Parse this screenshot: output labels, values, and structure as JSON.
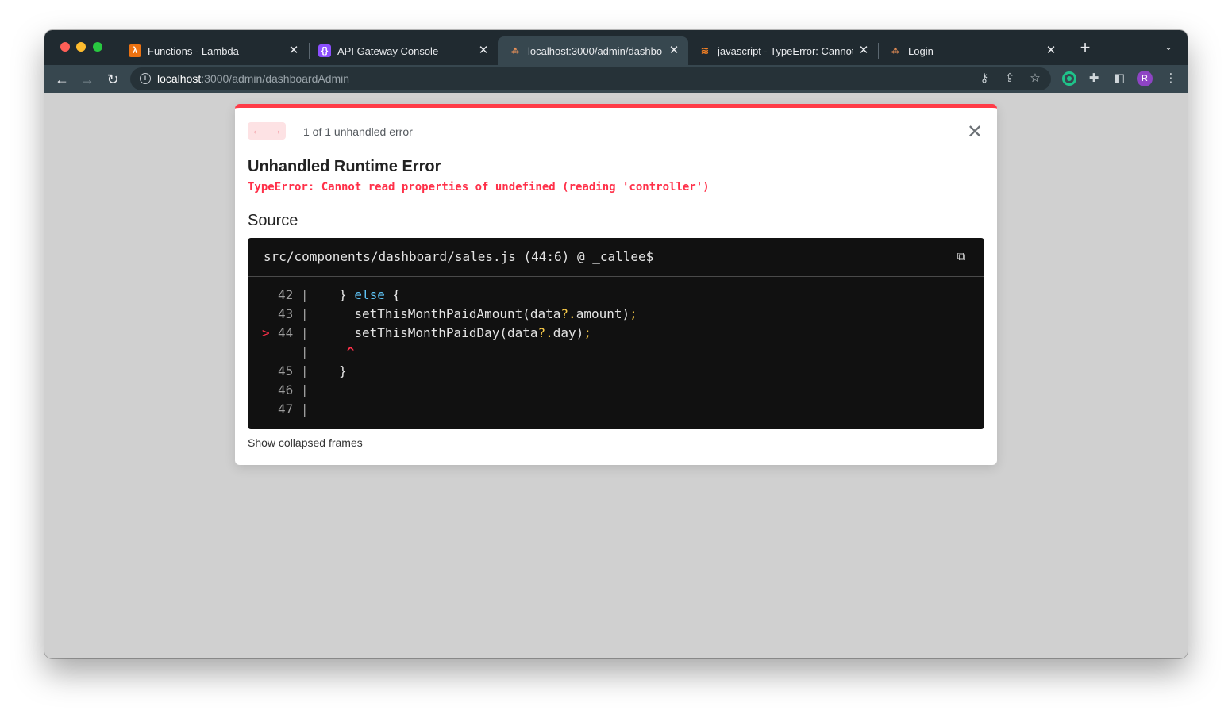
{
  "window": {
    "tabs": [
      {
        "title": "Functions - Lambda",
        "favicon": "aws-lambda-icon",
        "color": "#ec7211",
        "active": false
      },
      {
        "title": "API Gateway Console",
        "favicon": "api-gateway-icon",
        "color": "#8c4fff",
        "active": false
      },
      {
        "title": "localhost:3000/admin/dashbo",
        "favicon": "site-logo-icon",
        "active": true
      },
      {
        "title": "javascript - TypeError: Cannot",
        "favicon": "stackoverflow-icon",
        "color": "#f48024",
        "active": false
      },
      {
        "title": "Login",
        "favicon": "site-logo-icon",
        "active": false
      }
    ]
  },
  "toolbar": {
    "url_host": "localhost",
    "url_path": ":3000/admin/dashboardAdmin",
    "profile_initial": "R"
  },
  "dialog": {
    "counter": "1 of 1 unhandled error",
    "title": "Unhandled Runtime Error",
    "message": "TypeError: Cannot read properties of undefined (reading 'controller')",
    "source_heading": "Source",
    "file": "src/components/dashboard/sales.js (44:6) @ _callee$",
    "code_lines": [
      {
        "marker": "",
        "num": "42",
        "text": "    } else {"
      },
      {
        "marker": "",
        "num": "43",
        "text": "      setThisMonthPaidAmount(data?.amount);"
      },
      {
        "marker": ">",
        "num": "44",
        "text": "      setThisMonthPaidDay(data?.day);"
      },
      {
        "marker": "",
        "num": "",
        "text": "     ^"
      },
      {
        "marker": "",
        "num": "45",
        "text": "    }"
      },
      {
        "marker": "",
        "num": "46",
        "text": ""
      },
      {
        "marker": "",
        "num": "47",
        "text": ""
      }
    ],
    "show_frames": "Show collapsed frames"
  },
  "colors": {
    "accent_error": "#ff3b47",
    "tab_strip": "#202a30",
    "toolbar": "#37474f"
  }
}
